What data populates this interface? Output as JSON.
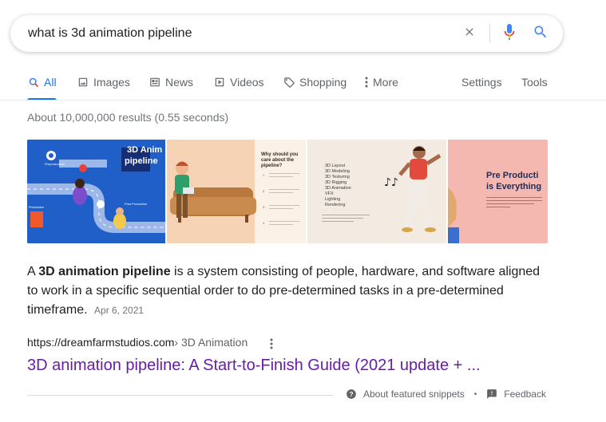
{
  "search": {
    "query": "what is 3d animation pipeline",
    "clear_icon": "close-icon",
    "mic_icon": "microphone-icon",
    "search_icon": "search-icon"
  },
  "tabs": [
    {
      "label": "All",
      "icon": "search-icon",
      "active": true
    },
    {
      "label": "Images",
      "icon": "image-icon"
    },
    {
      "label": "News",
      "icon": "news-icon"
    },
    {
      "label": "Videos",
      "icon": "video-icon"
    },
    {
      "label": "Shopping",
      "icon": "tag-icon"
    },
    {
      "label": "More",
      "icon": "more-vert-icon"
    },
    {
      "label": "Settings"
    },
    {
      "label": "Tools"
    }
  ],
  "result_stats": "About 10,000,000 results (0.55 seconds)",
  "images": [
    {
      "title_line1": "3D Anim",
      "title_line2": "pipeline",
      "labels": [
        "Preproduction",
        "Production",
        "Post Production"
      ]
    },
    {
      "heading_line1": "Why should you",
      "heading_line2": "care about the",
      "heading_line3": "pipeline?",
      "steps": [
        "1",
        "2",
        "3",
        "4"
      ]
    },
    {
      "list": [
        "3D Layout",
        "3D Modeling",
        "3D Texturing",
        "3D Rigging",
        "3D Animation",
        "VFX",
        "Lighting",
        "Rendering"
      ]
    },
    {
      "heading_line1": "Pre Producti",
      "heading_line2": "is Everything"
    }
  ],
  "snippet": {
    "prefix": "A ",
    "bold": "3D animation pipeline",
    "text": " is a system consisting of people, hardware, and software aligned to work in a specific sequential order to do pre-determined tasks in a pre-determined timeframe.",
    "date": "Apr 6, 2021"
  },
  "result": {
    "url": "https://dreamfarmstudios.com",
    "breadcrumb": " › 3D Animation",
    "title": "3D animation pipeline: A Start-to-Finish Guide (2021 update + ..."
  },
  "footer": {
    "about_label": "About featured snippets",
    "bullet": "•",
    "feedback_label": "Feedback"
  },
  "colors": {
    "link_visited": "#681da8",
    "accent": "#1a73e8",
    "muted": "#70757a"
  }
}
